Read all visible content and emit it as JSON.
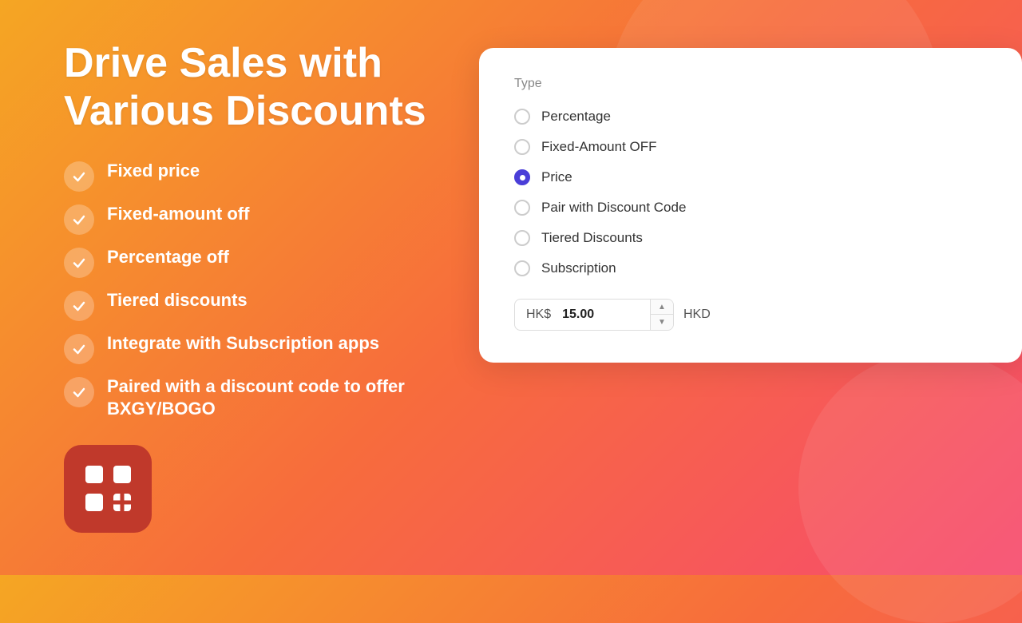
{
  "title": "Drive Sales with Various Discounts",
  "features": [
    {
      "id": "fixed-price",
      "label": "Fixed price"
    },
    {
      "id": "fixed-amount-off",
      "label": "Fixed-amount off"
    },
    {
      "id": "percentage-off",
      "label": "Percentage off"
    },
    {
      "id": "tiered-discounts",
      "label": "Tiered discounts"
    },
    {
      "id": "subscription-apps",
      "label": "Integrate with Subscription apps"
    },
    {
      "id": "bxgy-bogo",
      "label": "Paired with a discount code to offer BXGY/BOGO"
    }
  ],
  "card": {
    "type_label": "Type",
    "options": [
      {
        "id": "percentage",
        "label": "Percentage",
        "selected": false
      },
      {
        "id": "fixed-amount-off",
        "label": "Fixed-Amount OFF",
        "selected": false
      },
      {
        "id": "price",
        "label": "Price",
        "selected": true
      },
      {
        "id": "pair-discount-code",
        "label": "Pair with Discount Code",
        "selected": false
      },
      {
        "id": "tiered-discounts",
        "label": "Tiered Discounts",
        "selected": false
      },
      {
        "id": "subscription",
        "label": "Subscription",
        "selected": false
      }
    ],
    "price_prefix": "HK$",
    "price_value": "15.00",
    "currency": "HKD"
  }
}
